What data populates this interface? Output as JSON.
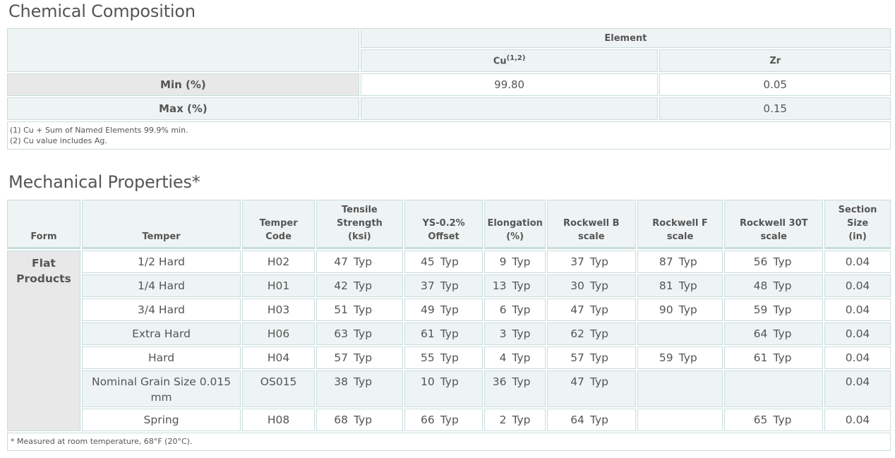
{
  "chemical": {
    "title": "Chemical Composition",
    "element_header": "Element",
    "columns": [
      {
        "name": "Cu",
        "sup": "(1,2)"
      },
      {
        "name": "Zr",
        "sup": ""
      }
    ],
    "rows": [
      {
        "label": "Min (%)",
        "values": [
          "99.80",
          "0.05"
        ]
      },
      {
        "label": "Max (%)",
        "values": [
          "",
          "0.15"
        ]
      }
    ],
    "notes": [
      "(1) Cu + Sum of Named Elements 99.9% min.",
      "(2) Cu value includes Ag."
    ]
  },
  "mechanical": {
    "title": "Mechanical Properties*",
    "headers": {
      "form": "Form",
      "temper": "Temper",
      "temper_code": [
        "Temper",
        "Code"
      ],
      "tensile": [
        "Tensile",
        "Strength",
        "(ksi)"
      ],
      "ys": [
        "YS-0.2%",
        "Offset"
      ],
      "elongation": [
        "Elongation",
        "(%)"
      ],
      "rockwell_b": [
        "Rockwell B",
        "scale"
      ],
      "rockwell_f": [
        "Rockwell F",
        "scale"
      ],
      "rockwell_30t": [
        "Rockwell 30T",
        "scale"
      ],
      "section": [
        "Section Size",
        "(in)"
      ]
    },
    "form": [
      "Flat",
      "Products"
    ],
    "typ": "Typ",
    "rows": [
      {
        "temper": "1/2 Hard",
        "code": "H02",
        "tensile": "47",
        "ys": "45",
        "elong": "9",
        "rb": "37",
        "rf": "87",
        "r30t": "56",
        "section": "0.04"
      },
      {
        "temper": "1/4 Hard",
        "code": "H01",
        "tensile": "42",
        "ys": "37",
        "elong": "13",
        "rb": "30",
        "rf": "81",
        "r30t": "48",
        "section": "0.04"
      },
      {
        "temper": "3/4 Hard",
        "code": "H03",
        "tensile": "51",
        "ys": "49",
        "elong": "6",
        "rb": "47",
        "rf": "90",
        "r30t": "59",
        "section": "0.04"
      },
      {
        "temper": "Extra Hard",
        "code": "H06",
        "tensile": "63",
        "ys": "61",
        "elong": "3",
        "rb": "62",
        "rf": "",
        "r30t": "64",
        "section": "0.04"
      },
      {
        "temper": "Hard",
        "code": "H04",
        "tensile": "57",
        "ys": "55",
        "elong": "4",
        "rb": "57",
        "rf": "59",
        "r30t": "61",
        "section": "0.04"
      },
      {
        "temper": "Nominal Grain Size 0.015 mm",
        "code": "OS015",
        "tensile": "38",
        "ys": "10",
        "elong": "36",
        "rb": "47",
        "rf": "",
        "r30t": "",
        "section": "0.04"
      },
      {
        "temper": "Spring",
        "code": "H08",
        "tensile": "68",
        "ys": "66",
        "elong": "2",
        "rb": "64",
        "rf": "",
        "r30t": "65",
        "section": "0.04"
      }
    ],
    "note": "* Measured at room temperature, 68°F (20°C)."
  }
}
